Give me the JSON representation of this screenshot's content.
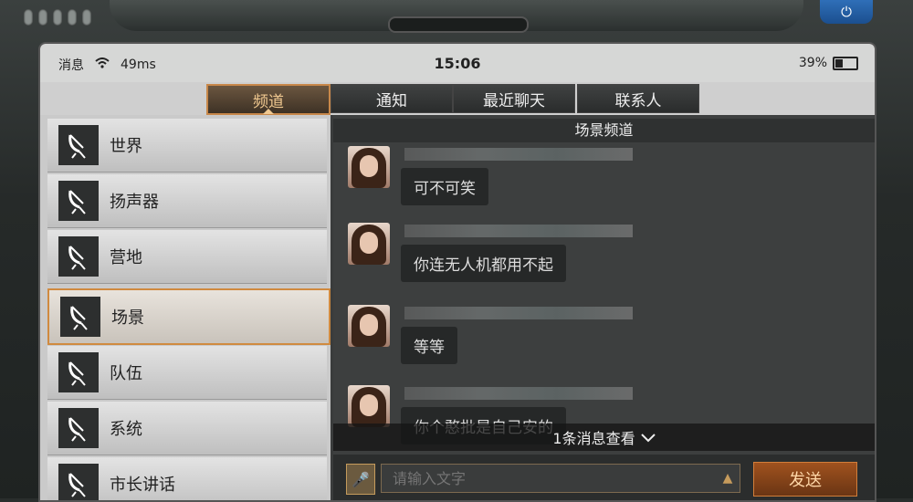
{
  "status_bar": {
    "message_label": "消息",
    "wifi_icon": "wifi-icon",
    "latency": "49ms",
    "time": "15:06",
    "battery": "39%"
  },
  "tabs": [
    {
      "label": "频道",
      "active": true
    },
    {
      "label": "通知"
    },
    {
      "label": "最近聊天"
    },
    {
      "label": "联系人"
    }
  ],
  "channels": [
    {
      "label": "世界",
      "icon": "satellite-dish-icon"
    },
    {
      "label": "扬声器",
      "icon": "satellite-dish-icon"
    },
    {
      "label": "营地",
      "icon": "satellite-dish-icon"
    },
    {
      "label": "场景",
      "icon": "satellite-dish-icon",
      "active": true
    },
    {
      "label": "队伍",
      "icon": "satellite-dish-icon"
    },
    {
      "label": "系统",
      "icon": "satellite-dish-icon"
    },
    {
      "label": "市长讲话",
      "icon": "satellite-dish-icon"
    }
  ],
  "chat": {
    "title": "场景频道",
    "messages": [
      {
        "text": "可不可笑"
      },
      {
        "text": "你连无人机都用不起"
      },
      {
        "text": "等等"
      },
      {
        "text": "你个憨批是自己安的"
      }
    ],
    "new_message_notice": "1条消息查看",
    "input_placeholder": "请输入文字",
    "send_label": "发送"
  },
  "colors": {
    "accent": "#d08a3f",
    "send_bg": "#8a4418"
  }
}
